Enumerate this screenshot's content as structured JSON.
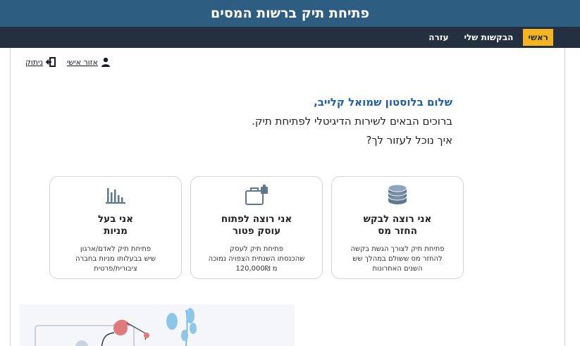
{
  "header": {
    "title": "פתיחת תיק ברשות המסים"
  },
  "nav": {
    "items": [
      {
        "label": "ראשי",
        "active": true
      },
      {
        "label": "הבקשות שלי",
        "active": false
      },
      {
        "label": "עזרה",
        "active": false
      }
    ]
  },
  "user_links": {
    "personal_area": "אזור אישי",
    "logout": "ניתוק"
  },
  "greeting": {
    "hello": "שלום בלוסטון שמואל קלייב,",
    "welcome": "ברוכים הבאים לשירות הדיגיטלי לפתיחת תיק.",
    "question": "איך נוכל לעזור לך?"
  },
  "cards": [
    {
      "icon": "coins-icon",
      "heading_line1": "אני רוצה לבקש",
      "heading_line2": "החזר מס",
      "desc_line1": "פתיחת תיק לצורך הגשת בקשה",
      "desc_line2": "להחזר מס ששולם במהלך שש",
      "desc_line3": "השנים האחרונות"
    },
    {
      "icon": "briefcase-icon",
      "heading_line1": "אני רוצה לפתוח",
      "heading_line2": "עוסק פטור",
      "desc_line1": "פתיחת תיק לעסק",
      "desc_line2": "שהכנסתו השנתית הצפויה נמוכה",
      "desc_line3": "מ 120,000₪"
    },
    {
      "icon": "bar-chart-icon",
      "heading_line1": "אני בעל",
      "heading_line2": "מניות",
      "desc_line1": "פתיחת תיק לאדם/ארגון",
      "desc_line2": "שיש בבעלותו מניות בחברה",
      "desc_line3": "ציבורית/פרטית"
    }
  ],
  "colors": {
    "title_bar": "#2e5d82",
    "nav_bar": "#243040",
    "nav_active": "#f5b521",
    "greeting_accent": "#1f5fa8",
    "icon": "#5d7890"
  }
}
